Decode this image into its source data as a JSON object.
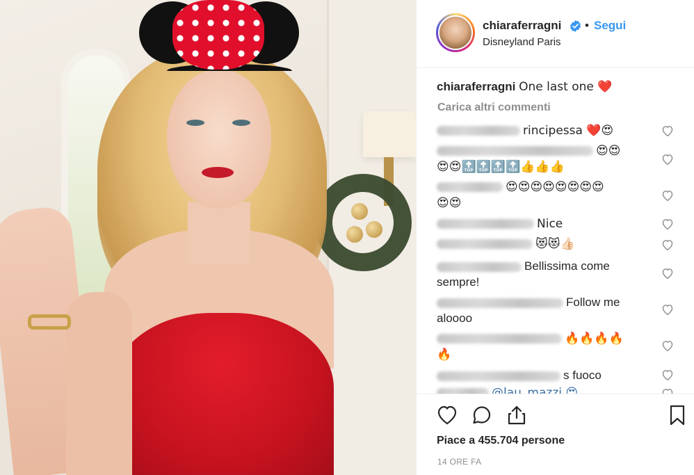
{
  "post": {
    "username": "chiaraferragni",
    "follow_label": "Segui",
    "dot": "•",
    "location": "Disneyland Paris",
    "caption_user": "chiaraferragni",
    "caption_text": "One last one ❤️",
    "load_more": "Carica altri commenti",
    "likes": "Piace a 455.704 persone",
    "time": "14 ORE FA"
  },
  "comments": [
    {
      "text": "rincipessa ❤️😍",
      "user_width": 120
    },
    {
      "text": "😍😍",
      "user_width": 225,
      "line2": "😍😍🔝🔝🔝🔝👍👍👍"
    },
    {
      "text": "😍😍😍😍😍😍😍😍",
      "user_width": 95,
      "line2": "😍😍"
    },
    {
      "text": "Nice",
      "user_width": 140
    },
    {
      "text": "😻😻👍🏻",
      "user_width": 138
    },
    {
      "text": "Bellissima come",
      "user_width": 122,
      "line2": "sempre!"
    },
    {
      "text": "Follow me",
      "user_width": 182,
      "line2": "aloooo"
    },
    {
      "text": "🔥🔥🔥🔥",
      "user_width": 180,
      "line2": "🔥"
    },
    {
      "text": "s fuoco",
      "user_width": 178
    },
    {
      "text": "@lau_mazzi 😍",
      "user_width": 75
    }
  ],
  "colors": {
    "link_blue": "#3897f0",
    "text": "#262626",
    "muted": "#8e8e8e",
    "border": "#efefef"
  },
  "icons": {
    "verified": "verified-badge-icon",
    "like": "heart-icon",
    "comment": "comment-icon",
    "share": "share-icon",
    "save": "bookmark-icon"
  }
}
